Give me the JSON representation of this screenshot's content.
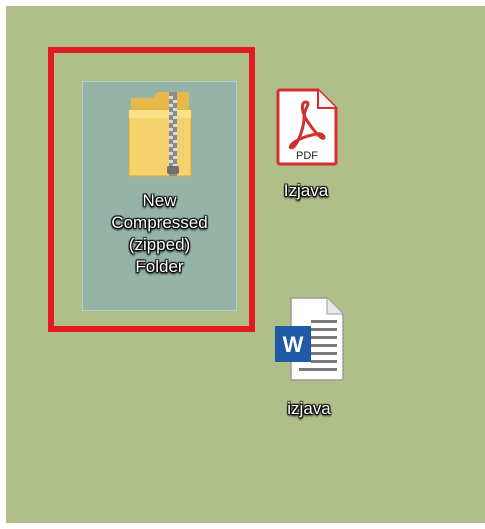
{
  "desktop": {
    "background_color": "#b0bf8a",
    "highlight_color": "#e21b23",
    "icons": [
      {
        "name": "zip-folder",
        "label": "New\nCompressed\n(zipped)\nFolder",
        "selected": true,
        "icon": "zipped-folder-icon"
      },
      {
        "name": "pdf-file",
        "label": "Izjava",
        "selected": false,
        "icon": "pdf-icon",
        "badge": "PDF"
      },
      {
        "name": "word-file",
        "label": "izjava",
        "selected": false,
        "icon": "word-doc-icon",
        "badge": "W"
      }
    ]
  }
}
